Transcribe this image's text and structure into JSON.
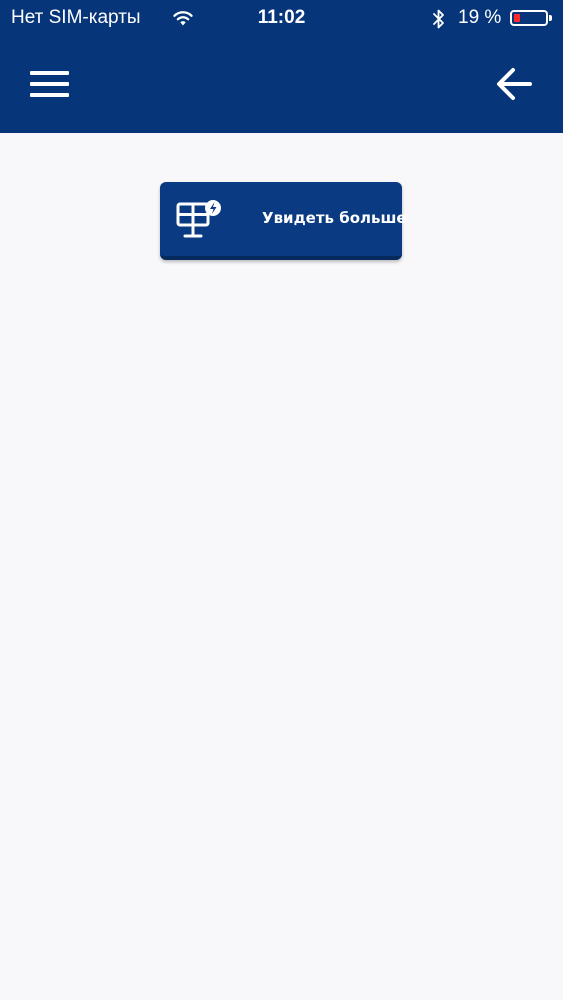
{
  "status_bar": {
    "carrier": "Нет SIM-карты",
    "time": "11:02",
    "battery_percent": "19 %",
    "battery_level": 0.19,
    "icons": [
      "wifi-icon",
      "bluetooth-icon",
      "battery-icon"
    ]
  },
  "nav": {
    "menu_icon": "hamburger-menu-icon",
    "back_icon": "back-arrow-icon"
  },
  "content": {
    "see_more_button": {
      "label": "Увидеть больше",
      "icon": "solar-panel-icon"
    }
  },
  "colors": {
    "header_bg": "#06357a",
    "button_bg": "#0a3a82",
    "page_bg": "#f8f8fb",
    "battery_low": "#ff2a2a"
  }
}
